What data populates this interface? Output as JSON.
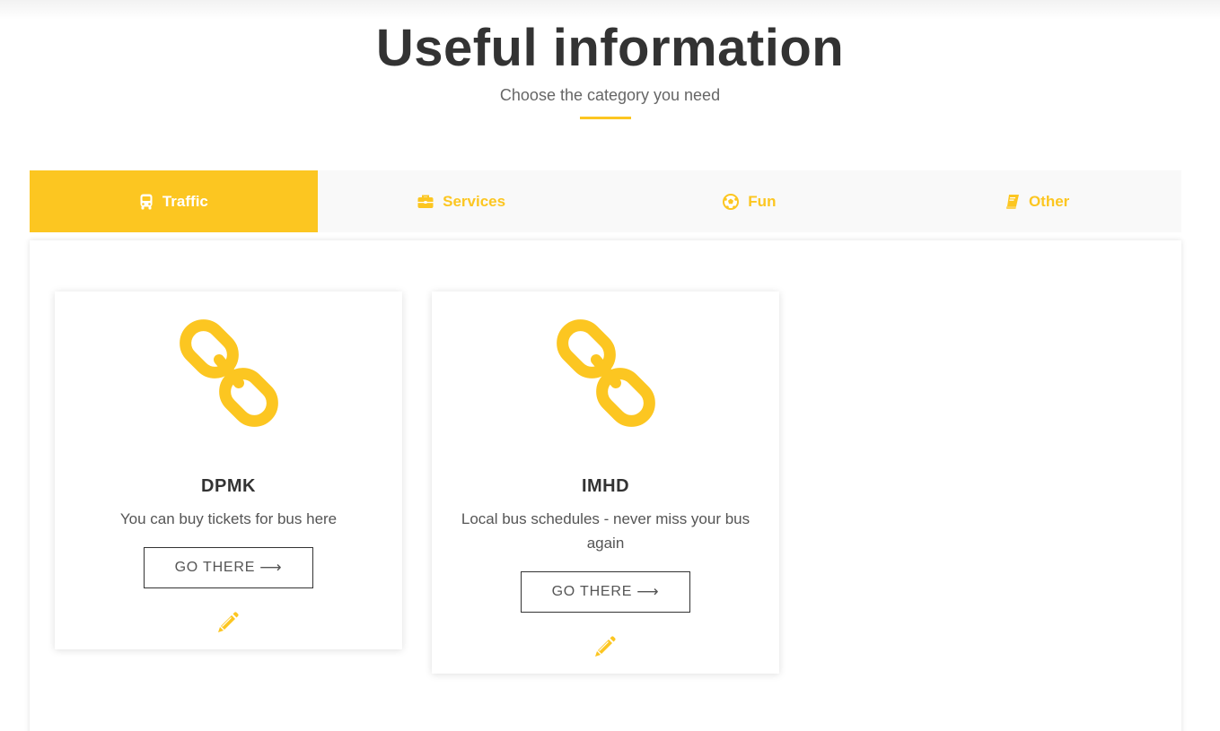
{
  "header": {
    "title": "Useful information",
    "subtitle": "Choose the category you need"
  },
  "tabs": [
    {
      "label": "Traffic",
      "icon": "bus-icon",
      "active": true
    },
    {
      "label": "Services",
      "icon": "briefcase-icon",
      "active": false
    },
    {
      "label": "Fun",
      "icon": "soccer-ball-icon",
      "active": false
    },
    {
      "label": "Other",
      "icon": "book-icon",
      "active": false
    }
  ],
  "cards": [
    {
      "title": "DPMK",
      "description": "You can buy tickets for bus here",
      "button_label": "GO THERE",
      "button_icon": "arrow-right-icon",
      "icon": "link-icon",
      "edit_icon": "pencil-icon"
    },
    {
      "title": "IMHD",
      "description": "Local bus schedules - never miss your bus again",
      "button_label": "GO THERE",
      "button_icon": "arrow-right-icon",
      "icon": "link-icon",
      "edit_icon": "pencil-icon"
    }
  ],
  "colors": {
    "accent": "#fcc621",
    "text_dark": "#333333",
    "text_muted": "#666666",
    "tab_bar_bg": "#f9f9f9"
  }
}
